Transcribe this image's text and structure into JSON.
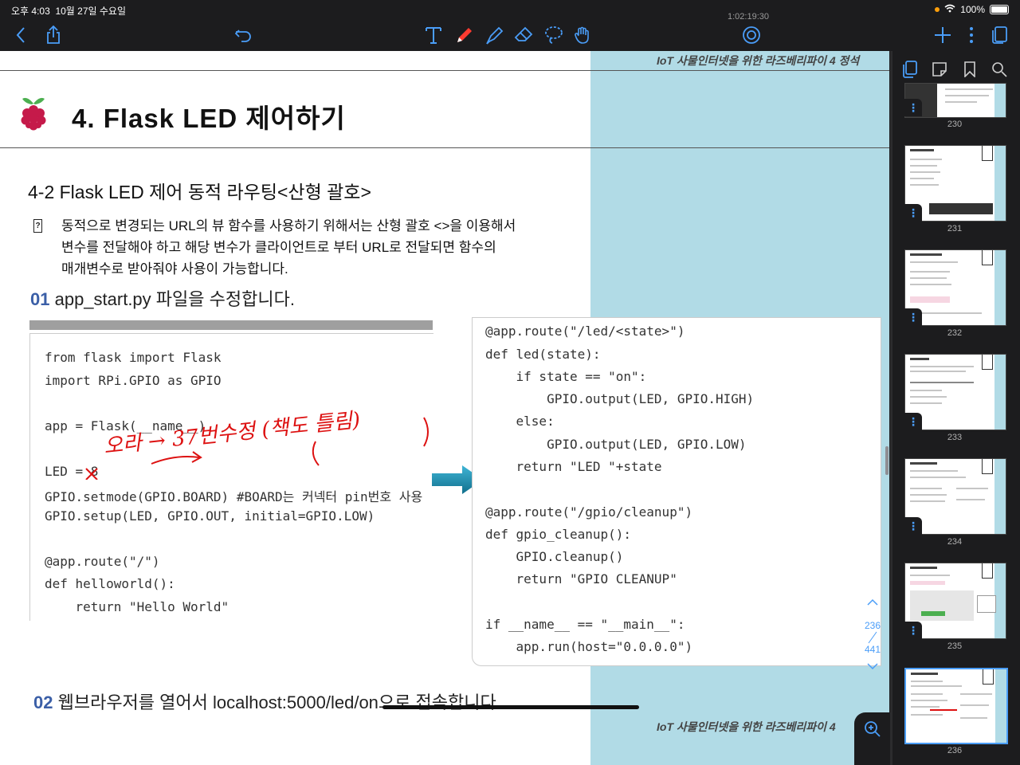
{
  "status": {
    "time": "오후 4:03",
    "date": "10월 27일 수요일",
    "battery": "100%"
  },
  "toolbar": {
    "timer": "1:02:19:30"
  },
  "page": {
    "header": "IoT 사물인터넷을 위한 라즈베리파이 4 정석",
    "footer": "IoT 사물인터넷을 위한 라즈베리파이 4",
    "title": "4. Flask LED 제어하기",
    "subtitle": "4-2 Flask LED 제어 동적 라우팅<산형 괄호>",
    "bullet_marker": "?",
    "paragraph": [
      "동적으로 변경되는 URL의 뷰 함수를 사용하기 위해서는 산형 괄호  <>을 이용해서",
      "변수를 전달해야 하고  해당 변수가 클라이언트로 부터 URL로 전달되면 함수의",
      "매개변수로 받아줘야 사용이 가능합니다."
    ],
    "step1": {
      "num": "01",
      "text": " app_start.py 파일을 수정합니다."
    },
    "step2": {
      "num": "02",
      "text": " 웹브라우저를 열어서 localhost:5000/led/on으로 접속합니다."
    },
    "annotation": "오라 → 37번수정 (책도 틀림)",
    "code_left": [
      "from flask import Flask",
      "import RPi.GPIO as GPIO",
      "",
      "app = Flask(__name__)",
      "",
      "LED = 8",
      "GPIO.setmode(GPIO.BOARD) #BOARD는 커넥터 pin번호 사용",
      "GPIO.setup(LED, GPIO.OUT, initial=GPIO.LOW)",
      "",
      "@app.route(\"/\")",
      "def helloworld():",
      "    return \"Hello World\""
    ],
    "code_right": [
      "@app.route(\"/led/<state>\")",
      "def led(state):",
      "    if state == \"on\":",
      "        GPIO.output(LED, GPIO.HIGH)",
      "    else:",
      "        GPIO.output(LED, GPIO.LOW)",
      "    return \"LED \"+state",
      "",
      "@app.route(\"/gpio/cleanup\")",
      "def gpio_cleanup():",
      "    GPIO.cleanup()",
      "    return \"GPIO CLEANUP\"",
      "",
      "if __name__ == \"__main__\":",
      "    app.run(host=\"0.0.0.0\")"
    ],
    "page_indicator": {
      "current": "236",
      "total": "441"
    }
  },
  "sidebar": {
    "thumbnails": [
      {
        "num": "230",
        "title": ""
      },
      {
        "num": "231",
        "title": "1. Flask 설치하기"
      },
      {
        "num": "232",
        "title": "2. Flask 웹 서버 구축하기"
      },
      {
        "num": "233",
        "title": "3. Flask 라우팅"
      },
      {
        "num": "234",
        "title": "4. Flask LED 제어하기"
      },
      {
        "num": "235",
        "title": "4. Flask LED 제어하기"
      },
      {
        "num": "236",
        "title": "4. Flask LED 제어하기"
      }
    ],
    "menu_glyph": "⋮"
  },
  "colors": {
    "accent": "#4a9df8",
    "blue_bg": "#b1dbe6",
    "step_num": "#3b5fa7",
    "arrow": "#1a8fb0",
    "ink": "#d11"
  }
}
